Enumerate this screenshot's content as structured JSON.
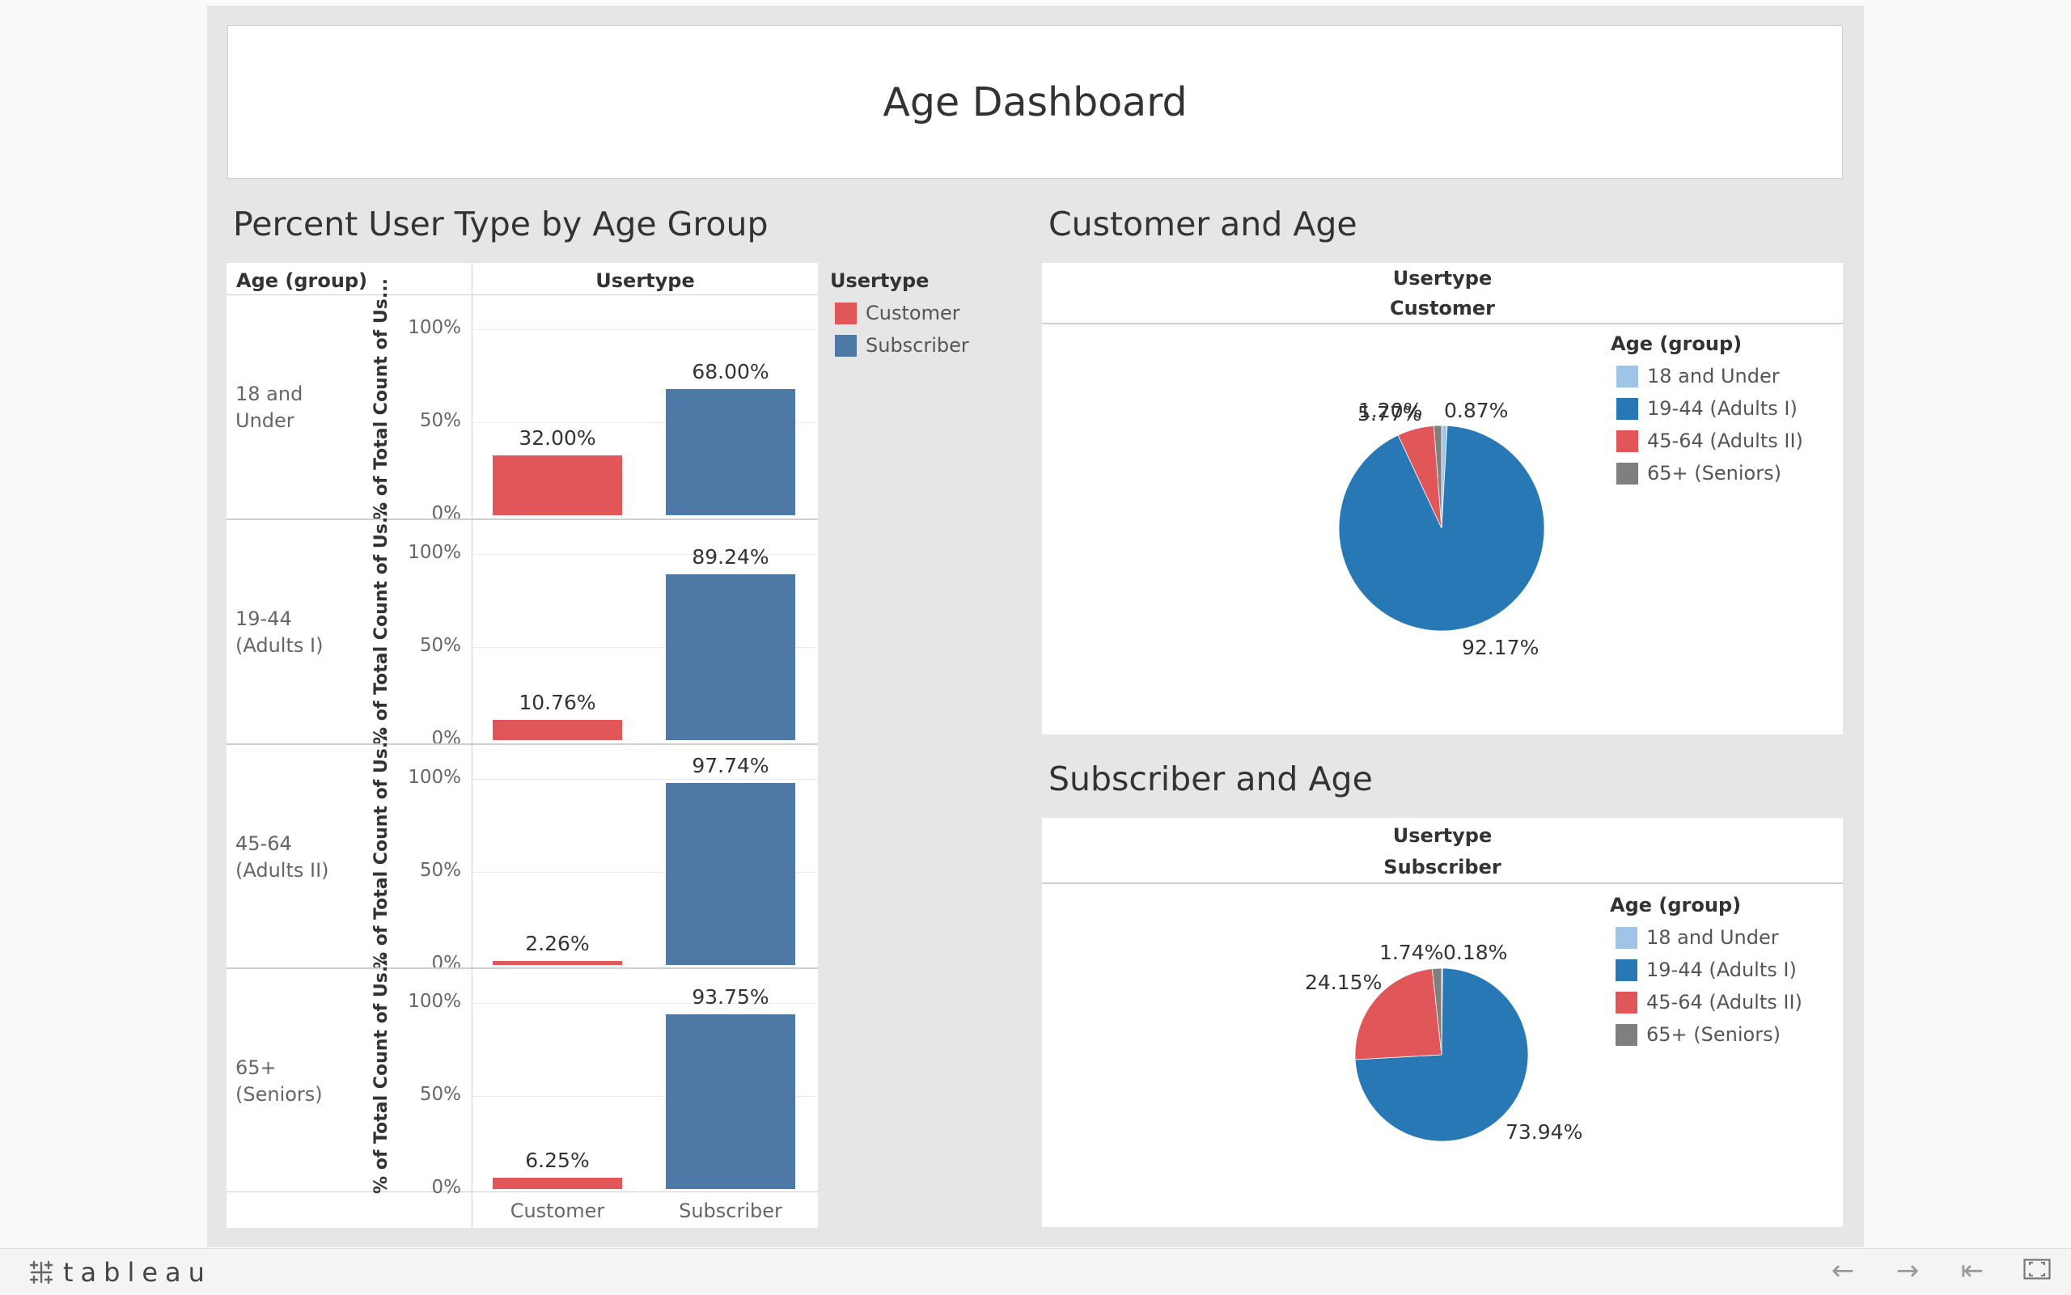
{
  "dashboard": {
    "title": "Age Dashboard"
  },
  "bar_sheet": {
    "title": "Percent User Type by Age Group",
    "row_header": "Age (group)",
    "column_header": "Usertype",
    "y_axis_label": "% of Total Count of Us...",
    "y_ticks": [
      "100%",
      "50%",
      "0%"
    ],
    "x_categories": [
      "Customer",
      "Subscriber"
    ],
    "rows": [
      {
        "label": "18 and\nUnder",
        "label_lines": [
          "18 and",
          "Under"
        ],
        "customer": "32.00%",
        "subscriber": "68.00%"
      },
      {
        "label": "19-44\n(Adults I)",
        "label_lines": [
          "19-44",
          "(Adults I)"
        ],
        "customer": "10.76%",
        "subscriber": "89.24%"
      },
      {
        "label": "45-64\n(Adults II)",
        "label_lines": [
          "45-64",
          "(Adults II)"
        ],
        "customer": "2.26%",
        "subscriber": "97.74%"
      },
      {
        "label": "65+\n(Seniors)",
        "label_lines": [
          "65+",
          "(Seniors)"
        ],
        "customer": "6.25%",
        "subscriber": "93.75%"
      }
    ]
  },
  "usertype_legend": {
    "title": "Usertype",
    "items": [
      {
        "label": "Customer",
        "color": "#e15759"
      },
      {
        "label": "Subscriber",
        "color": "#4e79a7"
      }
    ]
  },
  "customer_pie": {
    "title": "Customer and Age",
    "header_field": "Usertype",
    "header_value": "Customer",
    "labels": [
      "0.87%",
      "92.17%",
      "5.77%",
      "1.20%"
    ]
  },
  "subscriber_pie": {
    "title": "Subscriber and Age",
    "header_field": "Usertype",
    "header_value": "Subscriber",
    "labels": [
      "0.18%",
      "73.94%",
      "24.15%",
      "1.74%"
    ]
  },
  "age_legend": {
    "title": "Age (group)",
    "items": [
      {
        "label": "18 and Under",
        "color": "#a0c4e8"
      },
      {
        "label": "19-44 (Adults I)",
        "color": "#2878b5"
      },
      {
        "label": "45-64 (Adults II)",
        "color": "#e15759"
      },
      {
        "label": "65+ (Seniors)",
        "color": "#7f7f7f"
      }
    ]
  },
  "chart_data": [
    {
      "type": "bar",
      "title": "Percent User Type by Age Group",
      "xlabel": "Usertype",
      "ylabel": "% of Total Count of Us...",
      "ylim": [
        0,
        100
      ],
      "facet_field": "Age (group)",
      "categories": [
        "Customer",
        "Subscriber"
      ],
      "facets": [
        {
          "name": "18 and Under",
          "values": [
            32.0,
            68.0
          ]
        },
        {
          "name": "19-44 (Adults I)",
          "values": [
            10.76,
            89.24
          ]
        },
        {
          "name": "45-64 (Adults II)",
          "values": [
            2.26,
            97.74
          ]
        },
        {
          "name": "65+ (Seniors)",
          "values": [
            6.25,
            93.75
          ]
        }
      ],
      "colors": [
        "#e15759",
        "#4e79a7"
      ],
      "grid": true
    },
    {
      "type": "pie",
      "title": "Customer and Age",
      "categories": [
        "18 and Under",
        "19-44 (Adults I)",
        "45-64 (Adults II)",
        "65+ (Seniors)"
      ],
      "values": [
        0.87,
        92.17,
        5.77,
        1.2
      ],
      "colors": [
        "#a0c4e8",
        "#2878b5",
        "#e15759",
        "#7f7f7f"
      ]
    },
    {
      "type": "pie",
      "title": "Subscriber and Age",
      "categories": [
        "18 and Under",
        "19-44 (Adults I)",
        "45-64 (Adults II)",
        "65+ (Seniors)"
      ],
      "values": [
        0.18,
        73.94,
        24.15,
        1.74
      ],
      "colors": [
        "#a0c4e8",
        "#2878b5",
        "#e15759",
        "#7f7f7f"
      ]
    }
  ],
  "footer": {
    "brand": "tableau",
    "nav": [
      "back-arrow",
      "forward-arrow",
      "first-page",
      "fullscreen"
    ]
  }
}
